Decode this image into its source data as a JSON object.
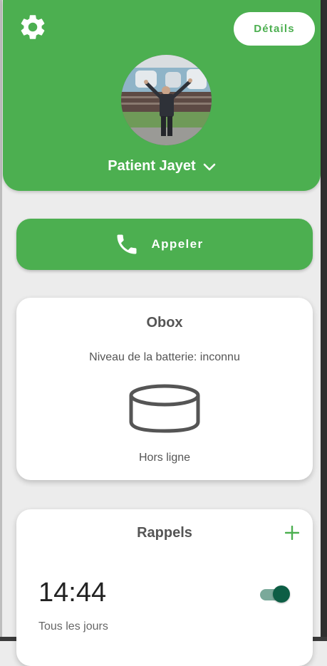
{
  "header": {
    "details_label": "Détails",
    "patient_name": "Patient Jayet",
    "settings_icon": "gear-icon",
    "dropdown_icon": "chevron-down-icon"
  },
  "call": {
    "label": "Appeler",
    "icon": "phone-icon"
  },
  "obox": {
    "title": "Obox",
    "battery": "Niveau de la batterie: inconnu",
    "device_icon": "obox-device-icon",
    "status": "Hors ligne"
  },
  "reminders": {
    "title": "Rappels",
    "add_icon": "plus-icon",
    "items": [
      {
        "time": "14:44",
        "recurrence": "Tous les jours",
        "enabled": true
      }
    ]
  },
  "colors": {
    "brand_green": "#4caf50",
    "toggle_on_thumb": "#0d5e45",
    "toggle_on_track": "#7aa99a"
  }
}
